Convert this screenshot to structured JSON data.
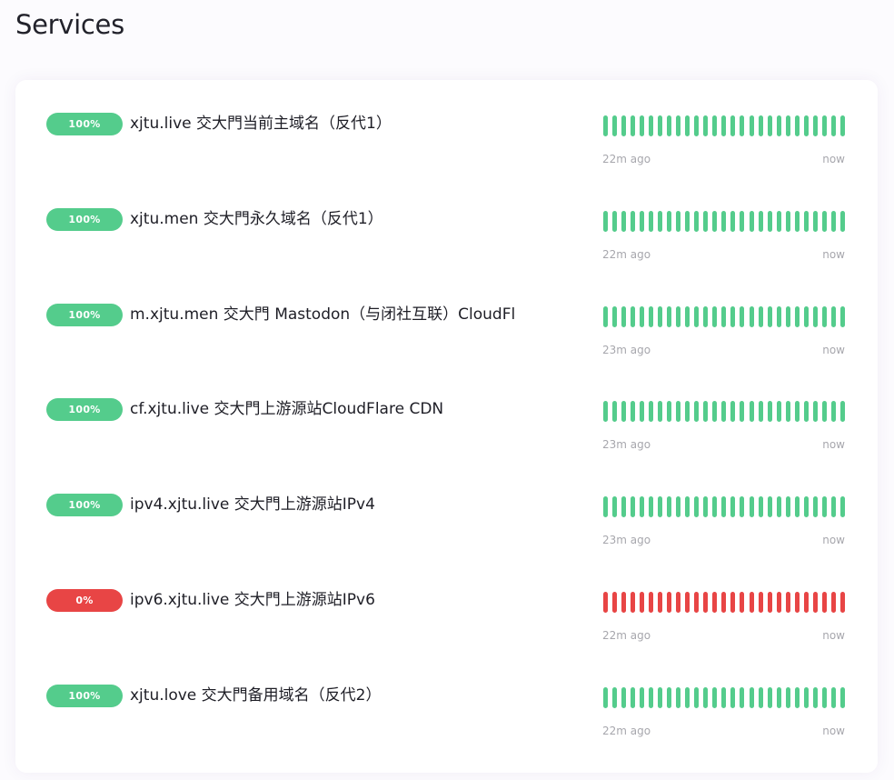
{
  "page": {
    "title": "Services"
  },
  "colors": {
    "up": "#54cc8c",
    "down": "#e84545"
  },
  "services": [
    {
      "uptime": "100%",
      "status": "up",
      "name": "xjtu.live 交大門当前主域名（反代1）",
      "heartbeats": [
        "up",
        "up",
        "up",
        "up",
        "up",
        "up",
        "up",
        "up",
        "up",
        "up",
        "up",
        "up",
        "up",
        "up",
        "up",
        "up",
        "up",
        "up",
        "up",
        "up",
        "up",
        "up",
        "up",
        "up",
        "up",
        "up",
        "up"
      ],
      "time_start": "22m ago",
      "time_end": "now"
    },
    {
      "uptime": "100%",
      "status": "up",
      "name": "xjtu.men 交大門永久域名（反代1）",
      "heartbeats": [
        "up",
        "up",
        "up",
        "up",
        "up",
        "up",
        "up",
        "up",
        "up",
        "up",
        "up",
        "up",
        "up",
        "up",
        "up",
        "up",
        "up",
        "up",
        "up",
        "up",
        "up",
        "up",
        "up",
        "up",
        "up",
        "up",
        "up"
      ],
      "time_start": "22m ago",
      "time_end": "now"
    },
    {
      "uptime": "100%",
      "status": "up",
      "name": "m.xjtu.men 交大門 Mastodon（与闭社互联）CloudFl",
      "heartbeats": [
        "up",
        "up",
        "up",
        "up",
        "up",
        "up",
        "up",
        "up",
        "up",
        "up",
        "up",
        "up",
        "up",
        "up",
        "up",
        "up",
        "up",
        "up",
        "up",
        "up",
        "up",
        "up",
        "up",
        "up",
        "up",
        "up",
        "up"
      ],
      "time_start": "23m ago",
      "time_end": "now"
    },
    {
      "uptime": "100%",
      "status": "up",
      "name": "cf.xjtu.live 交大門上游源站CloudFlare CDN",
      "heartbeats": [
        "up",
        "up",
        "up",
        "up",
        "up",
        "up",
        "up",
        "up",
        "up",
        "up",
        "up",
        "up",
        "up",
        "up",
        "up",
        "up",
        "up",
        "up",
        "up",
        "up",
        "up",
        "up",
        "up",
        "up",
        "up",
        "up",
        "up"
      ],
      "time_start": "23m ago",
      "time_end": "now"
    },
    {
      "uptime": "100%",
      "status": "up",
      "name": "ipv4.xjtu.live 交大門上游源站IPv4",
      "heartbeats": [
        "up",
        "up",
        "up",
        "up",
        "up",
        "up",
        "up",
        "up",
        "up",
        "up",
        "up",
        "up",
        "up",
        "up",
        "up",
        "up",
        "up",
        "up",
        "up",
        "up",
        "up",
        "up",
        "up",
        "up",
        "up",
        "up",
        "up"
      ],
      "time_start": "23m ago",
      "time_end": "now"
    },
    {
      "uptime": "0%",
      "status": "down",
      "name": "ipv6.xjtu.live 交大門上游源站IPv6",
      "heartbeats": [
        "down",
        "down",
        "down",
        "down",
        "down",
        "down",
        "down",
        "down",
        "down",
        "down",
        "down",
        "down",
        "down",
        "down",
        "down",
        "down",
        "down",
        "down",
        "down",
        "down",
        "down",
        "down",
        "down",
        "down",
        "down",
        "down",
        "down"
      ],
      "time_start": "22m ago",
      "time_end": "now"
    },
    {
      "uptime": "100%",
      "status": "up",
      "name": "xjtu.love 交大門备用域名（反代2）",
      "heartbeats": [
        "up",
        "up",
        "up",
        "up",
        "up",
        "up",
        "up",
        "up",
        "up",
        "up",
        "up",
        "up",
        "up",
        "up",
        "up",
        "up",
        "up",
        "up",
        "up",
        "up",
        "up",
        "up",
        "up",
        "up",
        "up",
        "up",
        "up"
      ],
      "time_start": "22m ago",
      "time_end": "now"
    }
  ]
}
